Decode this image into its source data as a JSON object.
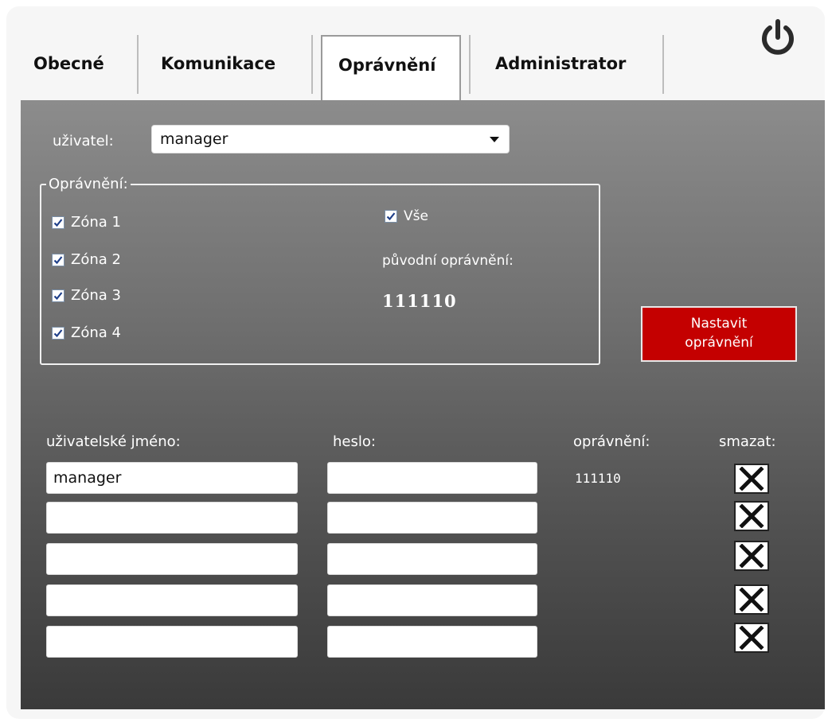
{
  "tabs": [
    {
      "label": "Obecné"
    },
    {
      "label": "Komunikace"
    },
    {
      "label": "Oprávnění"
    },
    {
      "label": "Administrator"
    }
  ],
  "user_select": {
    "label": "uživatel:",
    "value": "manager"
  },
  "permissions": {
    "legend": "Oprávnění:",
    "zones": [
      {
        "label": "Zóna 1",
        "checked": true
      },
      {
        "label": "Zóna 2",
        "checked": true
      },
      {
        "label": "Zóna 3",
        "checked": true
      },
      {
        "label": "Zóna 4",
        "checked": true
      }
    ],
    "all_label": "Vše",
    "all_checked": true,
    "original_label": "původní oprávnění:",
    "original_value": "111110"
  },
  "set_button": {
    "line1": "Nastavit",
    "line2": "oprávnění"
  },
  "users_table": {
    "headers": {
      "username": "uživatelské jméno:",
      "password": "heslo:",
      "permissions": "oprávnění:",
      "delete": "smazat:"
    },
    "rows": [
      {
        "username": "manager",
        "password": "",
        "permissions": "111110"
      },
      {
        "username": "",
        "password": "",
        "permissions": ""
      },
      {
        "username": "",
        "password": "",
        "permissions": ""
      },
      {
        "username": "",
        "password": "",
        "permissions": ""
      },
      {
        "username": "",
        "password": "",
        "permissions": ""
      }
    ]
  },
  "colors": {
    "accent_red": "#c40000",
    "panel_top": "#8c8c8c",
    "panel_bottom": "#3a3a3a"
  }
}
